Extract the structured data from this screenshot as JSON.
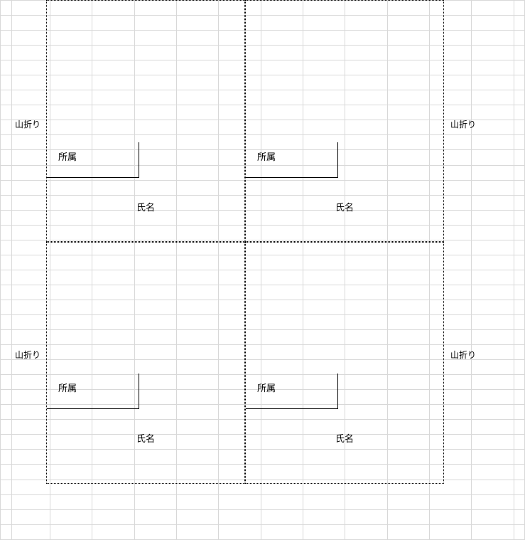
{
  "labels": {
    "mountain_fold": "山折り",
    "affiliation": "所属",
    "name": "氏名"
  },
  "cards": [
    {
      "row": 0,
      "col": 0
    },
    {
      "row": 0,
      "col": 1
    },
    {
      "row": 1,
      "col": 0
    },
    {
      "row": 1,
      "col": 1
    }
  ]
}
